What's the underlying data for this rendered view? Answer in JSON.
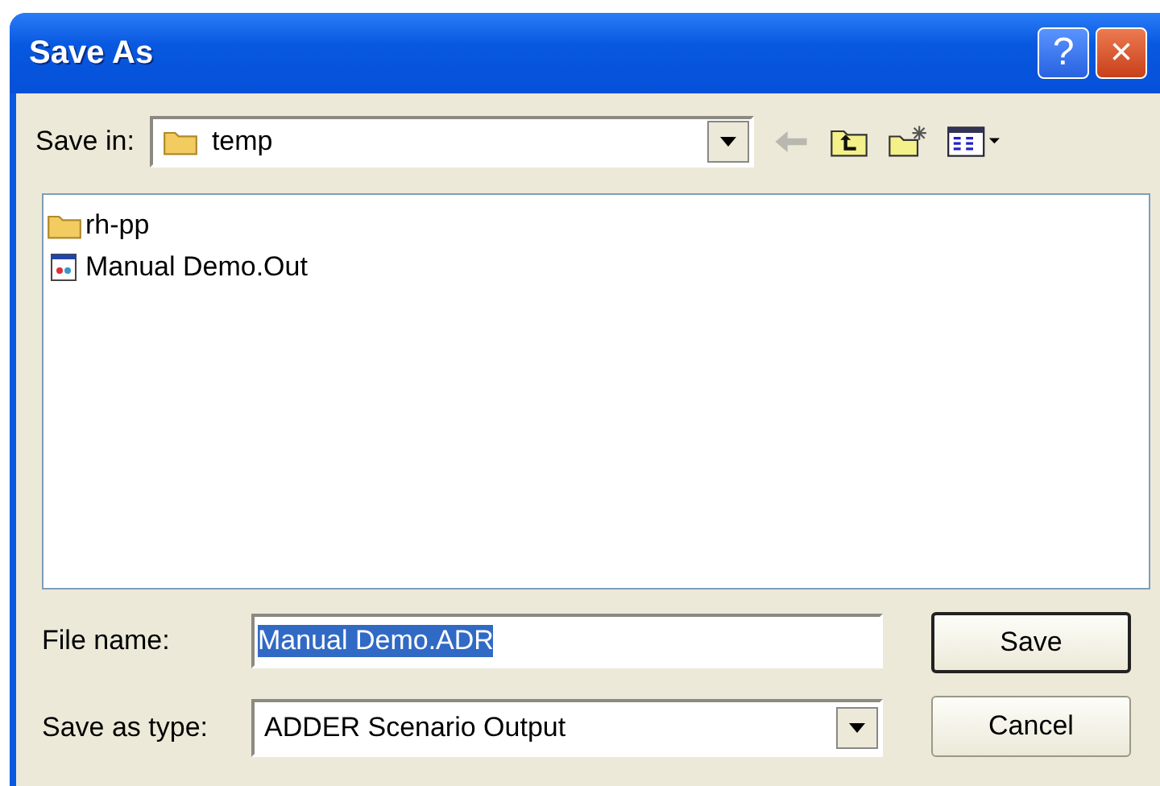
{
  "window": {
    "title": "Save As",
    "help_button": "?",
    "close_button": "×"
  },
  "save_in": {
    "label": "Save in:",
    "value": "temp"
  },
  "files": [
    {
      "name": "rh-pp",
      "kind": "folder",
      "selected": false
    },
    {
      "name": "Manual Demo.Out",
      "kind": "document",
      "selected": false
    }
  ],
  "file_name": {
    "label": "File name:",
    "value": "Manual Demo.ADR",
    "text_selected": true
  },
  "save_as_type": {
    "label": "Save as type:",
    "value": "ADDER Scenario Output"
  },
  "buttons": [
    {
      "label": "Save",
      "default": true
    },
    {
      "label": "Cancel",
      "default": false
    }
  ]
}
